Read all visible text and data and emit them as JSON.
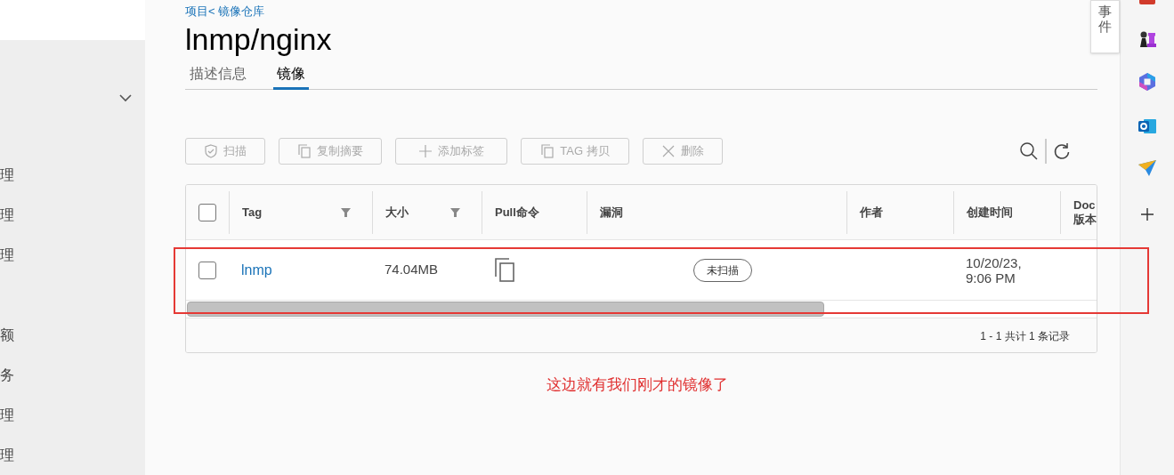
{
  "sidebar": {
    "items": [
      "理",
      "理",
      "理",
      "额",
      "务",
      "理",
      "理"
    ]
  },
  "breadcrumb": "项目< 镜像仓库",
  "title": "lnmp/nginx",
  "tabs": [
    {
      "label": "描述信息",
      "selected": false
    },
    {
      "label": "镜像",
      "selected": true
    }
  ],
  "toolbar": [
    {
      "kind": "shield",
      "label": "扫描",
      "disabled": true
    },
    {
      "kind": "copy",
      "label": "复制摘要",
      "disabled": true
    },
    {
      "kind": "plus",
      "label": "添加标签",
      "disabled": true
    },
    {
      "kind": "copy",
      "label": "TAG 拷贝",
      "disabled": true
    },
    {
      "kind": "close",
      "label": "删除",
      "disabled": true
    }
  ],
  "table": {
    "select_all_checked": false,
    "columns": [
      {
        "label": "Tag",
        "filter": true
      },
      {
        "label": "大小",
        "filter": true
      },
      {
        "label": "Pull命令"
      },
      {
        "label": "漏洞"
      },
      {
        "label": "作者"
      },
      {
        "label": "创建时间"
      },
      {
        "label": "Doc\n版本"
      }
    ],
    "rows": [
      {
        "checked": false,
        "tag": "lnmp",
        "size": "74.04MB",
        "vulnerability": "未扫描",
        "created": "10/20/23,\n9:06 PM"
      }
    ],
    "footer": "1 - 1 共计 1 条记录"
  },
  "annotation": "这边就有我们刚才的镜像了",
  "side_panel_tab": "事件"
}
